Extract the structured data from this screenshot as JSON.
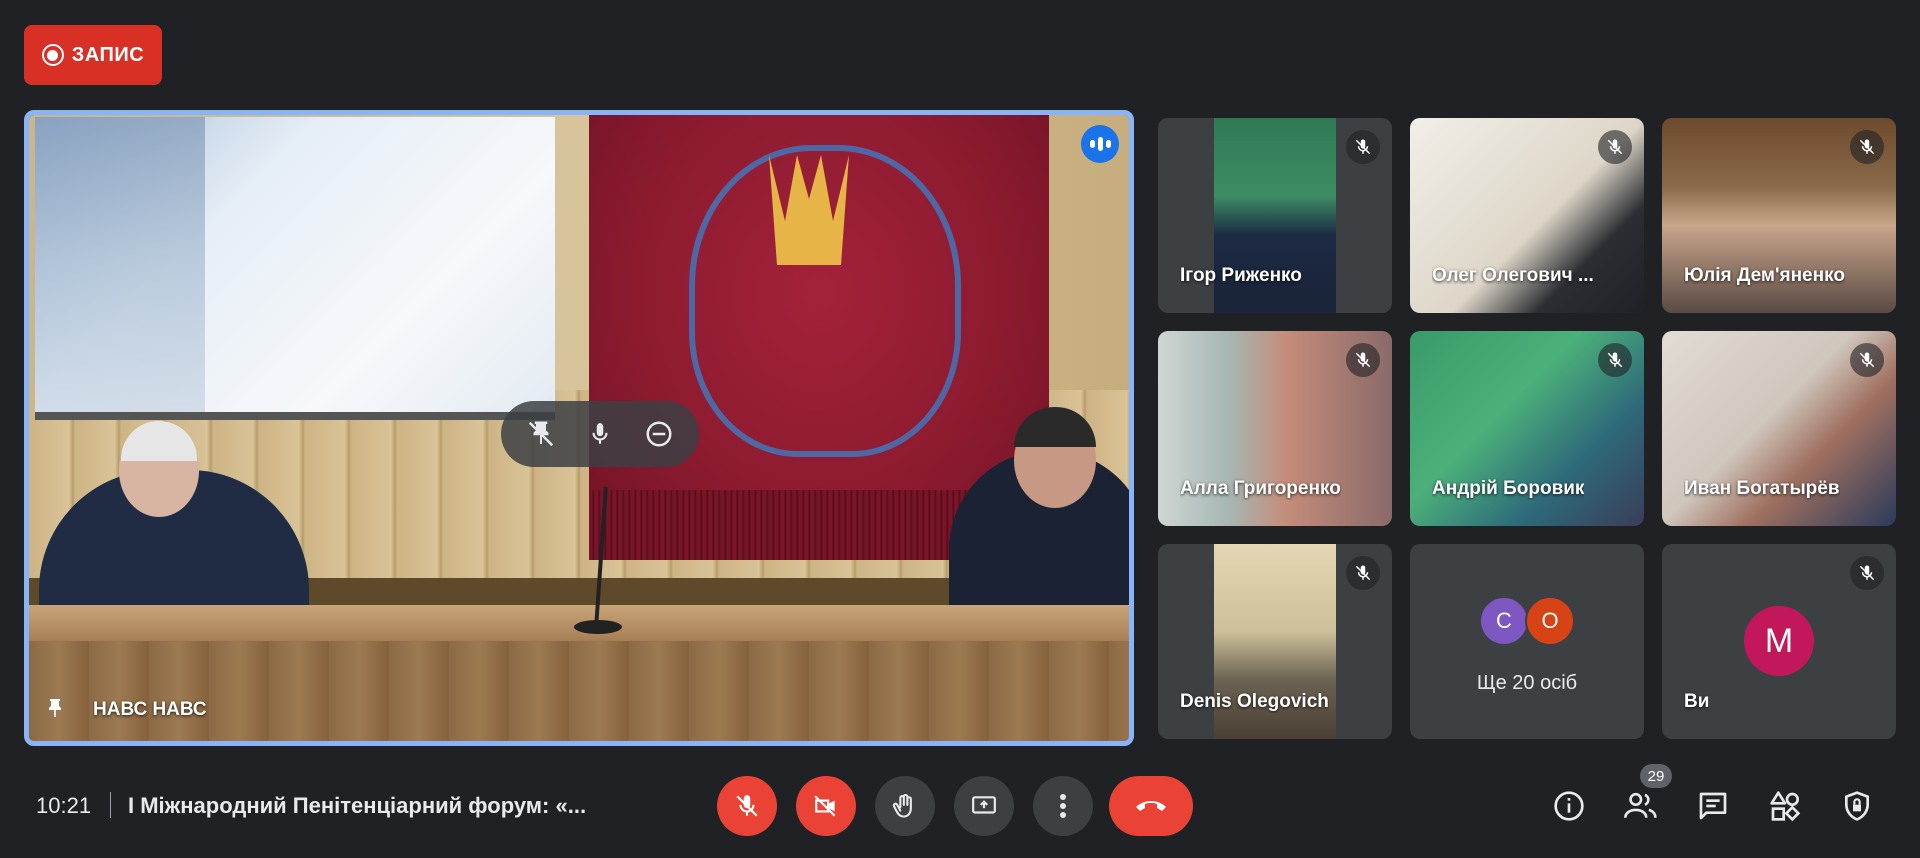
{
  "recording": {
    "label": "ЗАПИС"
  },
  "main_tile": {
    "participant_name": "НАВС НАВС",
    "pinned": true,
    "speaking": true
  },
  "participants": [
    {
      "name": "Ігор Риженко",
      "muted": true
    },
    {
      "name": "Олег Олегович ...",
      "muted": true
    },
    {
      "name": "Юлія Дем'яненко",
      "muted": true
    },
    {
      "name": "Алла Григоренко",
      "muted": true
    },
    {
      "name": "Андрій Боровик",
      "muted": true
    },
    {
      "name": "Иван Богатырёв",
      "muted": true
    },
    {
      "name": "Denis Olegovich",
      "muted": true
    }
  ],
  "more_tile": {
    "avatars": [
      {
        "initial": "С",
        "color": "#7e57c2"
      },
      {
        "initial": "О",
        "color": "#d84315"
      }
    ],
    "label": "Ще 20 осіб"
  },
  "self_tile": {
    "name": "Ви",
    "initial": "M",
    "avatar_color": "#c2185b",
    "muted": true
  },
  "bottom_bar": {
    "time": "10:21",
    "meeting_title": "І Міжнародний Пенітенціарний форум: «...",
    "participant_count": "29"
  },
  "controls": {
    "mic": {
      "icon": "mic-off-icon",
      "state": "off"
    },
    "camera": {
      "icon": "camera-off-icon",
      "state": "off"
    },
    "raise_hand": {
      "icon": "hand-icon"
    },
    "present": {
      "icon": "present-screen-icon"
    },
    "more": {
      "icon": "more-vert-icon"
    },
    "leave": {
      "icon": "phone-hangup-icon"
    }
  },
  "side_controls": [
    "info-icon",
    "people-icon",
    "chat-icon",
    "activities-icon",
    "host-controls-icon"
  ],
  "colors": {
    "background": "#202124",
    "tile": "#3c4043",
    "danger": "#ea4335",
    "accent": "#8ab4f8"
  }
}
